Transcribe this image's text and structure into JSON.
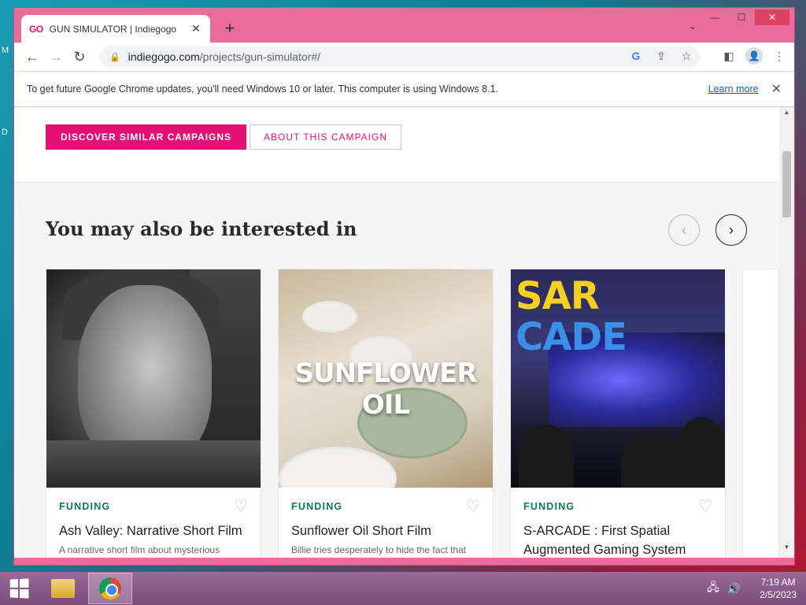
{
  "desktop": {
    "letters": [
      "M",
      "D"
    ]
  },
  "browser": {
    "tab_favicon": "GO",
    "tab_title": "GUN SIMULATOR | Indiegogo",
    "tab_close": "✕",
    "new_tab": "+",
    "tab_search": "⌄",
    "win_min": "—",
    "win_max": "☐",
    "win_close": "✕",
    "back": "←",
    "forward": "→",
    "reload": "↻",
    "url_host": "indiegogo.com",
    "url_path": "/projects/gun-simulator#/",
    "lock_icon": "🔒",
    "google_icon": "G",
    "share_icon": "⇪",
    "star_icon": "☆",
    "sidepanel_icon": "◧",
    "profile_icon": "👤",
    "menu_icon": "⋮"
  },
  "infobar": {
    "text": "To get future Google Chrome updates, you'll need Windows 10 or later. This computer is using Windows 8.1.",
    "learn_more": "Learn more",
    "close": "✕"
  },
  "page": {
    "discover_btn": "DISCOVER SIMILAR CAMPAIGNS",
    "about_btn": "ABOUT THIS CAMPAIGN",
    "rec_title": "You may also be interested in",
    "prev_arrow": "‹",
    "next_arrow": "›",
    "cards": [
      {
        "label": "FUNDING",
        "title": "Ash Valley: Narrative Short Film",
        "desc": "A narrative short film about mysterious",
        "heart": "♡"
      },
      {
        "label": "FUNDING",
        "title": "Sunflower Oil Short Film",
        "desc": "Billie tries desperately to hide the fact that",
        "heart": "♡",
        "image_text": "SUNFLOWER OIL"
      },
      {
        "label": "FUNDING",
        "title": "S-ARCADE : First Spatial Augmented Gaming System",
        "desc": "",
        "heart": "♡",
        "logo_1": "SAR",
        "logo_2": "CADE"
      }
    ]
  },
  "scrollbar": {
    "up": "▲",
    "down": "▼"
  },
  "taskbar": {
    "time": "7:19 AM",
    "date": "2/5/2023",
    "network_icon": "🖧",
    "volume_icon": "🔊"
  },
  "colors": {
    "brand": "#e51075",
    "funding_green": "#0b7a5a",
    "window_frame": "#e96d9a"
  }
}
